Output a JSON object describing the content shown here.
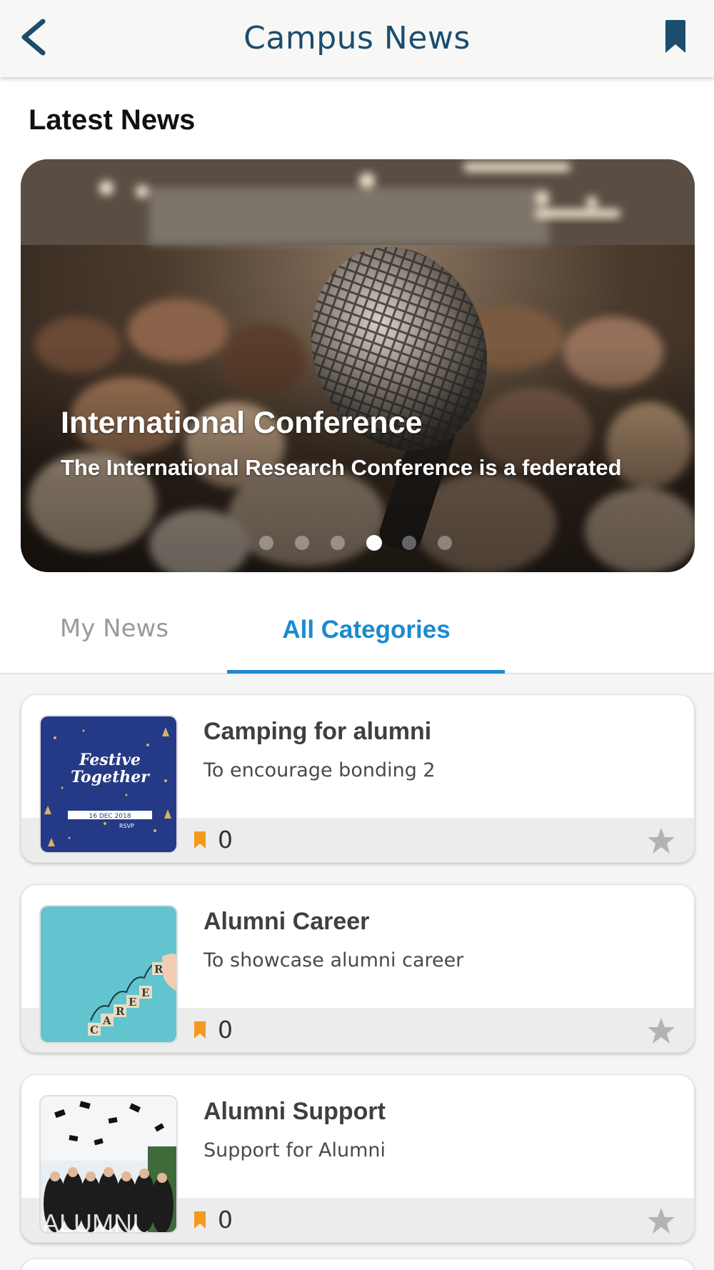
{
  "header": {
    "title": "Campus News",
    "back_icon": "chevron-left-icon",
    "bookmark_icon": "bookmark-icon",
    "accent_color": "#1b4d6e"
  },
  "latest": {
    "section_title": "Latest News",
    "banner": {
      "title": "International Conference",
      "description": "The International Research Conference is a federated",
      "slide_count": 6,
      "active_slide": 4
    }
  },
  "tabs": {
    "items": [
      {
        "label": "My News",
        "active": false
      },
      {
        "label": "All Categories",
        "active": true
      }
    ],
    "active_color": "#1b8ad0"
  },
  "news": {
    "items": [
      {
        "title": "Camping for alumni",
        "description": "To encourage bonding 2",
        "bookmark_count": "0",
        "thumb_text": "Festive Together",
        "thumb_date": "16 DEC 2018",
        "thumb_rsvp": "RSVP"
      },
      {
        "title": "Alumni Career",
        "description": "To showcase alumni career",
        "bookmark_count": "0",
        "thumb_text": "CAREER"
      },
      {
        "title": "Alumni Support",
        "description": "Support for Alumni",
        "bookmark_count": "0",
        "thumb_text": "ALUMNI"
      }
    ],
    "bookmark_color": "#f39a1e",
    "star_color": "#b3b3b3"
  }
}
